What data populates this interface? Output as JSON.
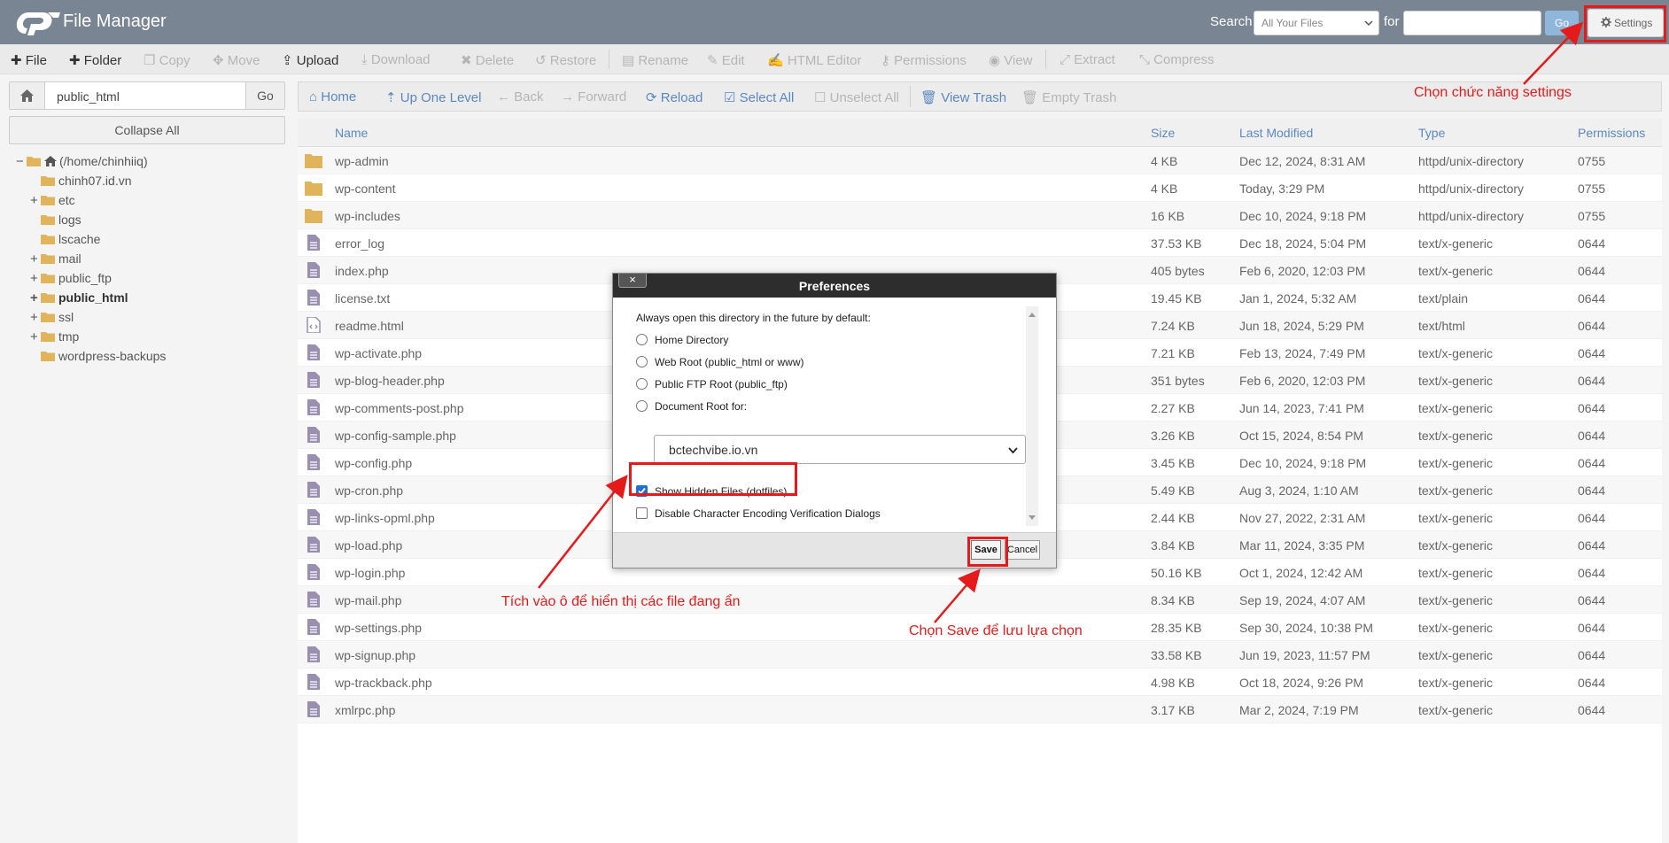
{
  "header": {
    "app_title": "File Manager",
    "search_label": "Search",
    "search_scope": "All Your Files",
    "for_label": "for",
    "search_value": "",
    "go_label": "Go",
    "settings_label": "Settings"
  },
  "toolbar": {
    "file": "File",
    "folder": "Folder",
    "copy": "Copy",
    "move": "Move",
    "upload": "Upload",
    "download": "Download",
    "delete": "Delete",
    "restore": "Restore",
    "rename": "Rename",
    "edit": "Edit",
    "html_editor": "HTML Editor",
    "permissions": "Permissions",
    "view": "View",
    "extract": "Extract",
    "compress": "Compress"
  },
  "sidebar": {
    "path_value": "public_html",
    "go_label": "Go",
    "collapse_label": "Collapse All",
    "tree": [
      {
        "label": "(/home/chinhiiq)",
        "prefix": "−",
        "root": true
      },
      {
        "label": "chinh07.id.vn",
        "prefix": ""
      },
      {
        "label": "etc",
        "prefix": "+"
      },
      {
        "label": "logs",
        "prefix": ""
      },
      {
        "label": "lscache",
        "prefix": ""
      },
      {
        "label": "mail",
        "prefix": "+"
      },
      {
        "label": "public_ftp",
        "prefix": "+"
      },
      {
        "label": "public_html",
        "prefix": "+",
        "bold": true
      },
      {
        "label": "ssl",
        "prefix": "+"
      },
      {
        "label": "tmp",
        "prefix": "+"
      },
      {
        "label": "wordpress-backups",
        "prefix": ""
      }
    ]
  },
  "nav": {
    "home": "Home",
    "up": "Up One Level",
    "back": "Back",
    "forward": "Forward",
    "reload": "Reload",
    "select_all": "Select All",
    "unselect_all": "Unselect All",
    "view_trash": "View Trash",
    "empty_trash": "Empty Trash"
  },
  "table": {
    "headers": {
      "name": "Name",
      "size": "Size",
      "modified": "Last Modified",
      "type": "Type",
      "perms": "Permissions"
    },
    "rows": [
      {
        "name": "wp-admin",
        "size": "4 KB",
        "modified": "Dec 12, 2024, 8:31 AM",
        "type": "httpd/unix-directory",
        "perms": "0755",
        "kind": "folder"
      },
      {
        "name": "wp-content",
        "size": "4 KB",
        "modified": "Today, 3:29 PM",
        "type": "httpd/unix-directory",
        "perms": "0755",
        "kind": "folder"
      },
      {
        "name": "wp-includes",
        "size": "16 KB",
        "modified": "Dec 10, 2024, 9:18 PM",
        "type": "httpd/unix-directory",
        "perms": "0755",
        "kind": "folder"
      },
      {
        "name": "error_log",
        "size": "37.53 KB",
        "modified": "Dec 18, 2024, 5:04 PM",
        "type": "text/x-generic",
        "perms": "0644",
        "kind": "file"
      },
      {
        "name": "index.php",
        "size": "405 bytes",
        "modified": "Feb 6, 2020, 12:03 PM",
        "type": "text/x-generic",
        "perms": "0644",
        "kind": "file"
      },
      {
        "name": "license.txt",
        "size": "19.45 KB",
        "modified": "Jan 1, 2024, 5:32 AM",
        "type": "text/plain",
        "perms": "0644",
        "kind": "file"
      },
      {
        "name": "readme.html",
        "size": "7.24 KB",
        "modified": "Jun 18, 2024, 5:29 PM",
        "type": "text/html",
        "perms": "0644",
        "kind": "html"
      },
      {
        "name": "wp-activate.php",
        "size": "7.21 KB",
        "modified": "Feb 13, 2024, 7:49 PM",
        "type": "text/x-generic",
        "perms": "0644",
        "kind": "file"
      },
      {
        "name": "wp-blog-header.php",
        "size": "351 bytes",
        "modified": "Feb 6, 2020, 12:03 PM",
        "type": "text/x-generic",
        "perms": "0644",
        "kind": "file"
      },
      {
        "name": "wp-comments-post.php",
        "size": "2.27 KB",
        "modified": "Jun 14, 2023, 7:41 PM",
        "type": "text/x-generic",
        "perms": "0644",
        "kind": "file"
      },
      {
        "name": "wp-config-sample.php",
        "size": "3.26 KB",
        "modified": "Oct 15, 2024, 8:54 PM",
        "type": "text/x-generic",
        "perms": "0644",
        "kind": "file"
      },
      {
        "name": "wp-config.php",
        "size": "3.45 KB",
        "modified": "Dec 10, 2024, 9:18 PM",
        "type": "text/x-generic",
        "perms": "0644",
        "kind": "file"
      },
      {
        "name": "wp-cron.php",
        "size": "5.49 KB",
        "modified": "Aug 3, 2024, 1:10 AM",
        "type": "text/x-generic",
        "perms": "0644",
        "kind": "file"
      },
      {
        "name": "wp-links-opml.php",
        "size": "2.44 KB",
        "modified": "Nov 27, 2022, 2:31 AM",
        "type": "text/x-generic",
        "perms": "0644",
        "kind": "file"
      },
      {
        "name": "wp-load.php",
        "size": "3.84 KB",
        "modified": "Mar 11, 2024, 3:35 PM",
        "type": "text/x-generic",
        "perms": "0644",
        "kind": "file"
      },
      {
        "name": "wp-login.php",
        "size": "50.16 KB",
        "modified": "Oct 1, 2024, 12:42 AM",
        "type": "text/x-generic",
        "perms": "0644",
        "kind": "file"
      },
      {
        "name": "wp-mail.php",
        "size": "8.34 KB",
        "modified": "Sep 19, 2024, 4:07 AM",
        "type": "text/x-generic",
        "perms": "0644",
        "kind": "file"
      },
      {
        "name": "wp-settings.php",
        "size": "28.35 KB",
        "modified": "Sep 30, 2024, 10:38 PM",
        "type": "text/x-generic",
        "perms": "0644",
        "kind": "file"
      },
      {
        "name": "wp-signup.php",
        "size": "33.58 KB",
        "modified": "Jun 19, 2023, 11:57 PM",
        "type": "text/x-generic",
        "perms": "0644",
        "kind": "file"
      },
      {
        "name": "wp-trackback.php",
        "size": "4.98 KB",
        "modified": "Oct 18, 2024, 9:26 PM",
        "type": "text/x-generic",
        "perms": "0644",
        "kind": "file"
      },
      {
        "name": "xmlrpc.php",
        "size": "3.17 KB",
        "modified": "Mar 2, 2024, 7:19 PM",
        "type": "text/x-generic",
        "perms": "0644",
        "kind": "file"
      }
    ]
  },
  "modal": {
    "title": "Preferences",
    "close": "×",
    "intro": "Always open this directory in the future by default:",
    "options": [
      "Home Directory",
      "Web Root (public_html or www)",
      "Public FTP Root (public_ftp)",
      "Document Root for:"
    ],
    "doc_root_value": "bctechvibe.io.vn",
    "show_hidden": "Show Hidden Files (dotfiles)",
    "show_hidden_checked": true,
    "disable_encoding": "Disable Character Encoding Verification Dialogs",
    "save": "Save",
    "cancel": "Cancel"
  },
  "annotations": {
    "settings_note": "Chọn chức năng settings",
    "hidden_note": "Tích vào ô để hiển thị các file đang ẩn",
    "save_note": "Chọn Save để lưu lựa chọn"
  },
  "colors": {
    "header_bg": "#7a8593",
    "link_blue": "#5b88c2",
    "folder": "#e0b45a",
    "file_icon": "#9a8fb0",
    "annotation_red": "#e51b1b",
    "checkbox_blue": "#1e6fd9"
  }
}
